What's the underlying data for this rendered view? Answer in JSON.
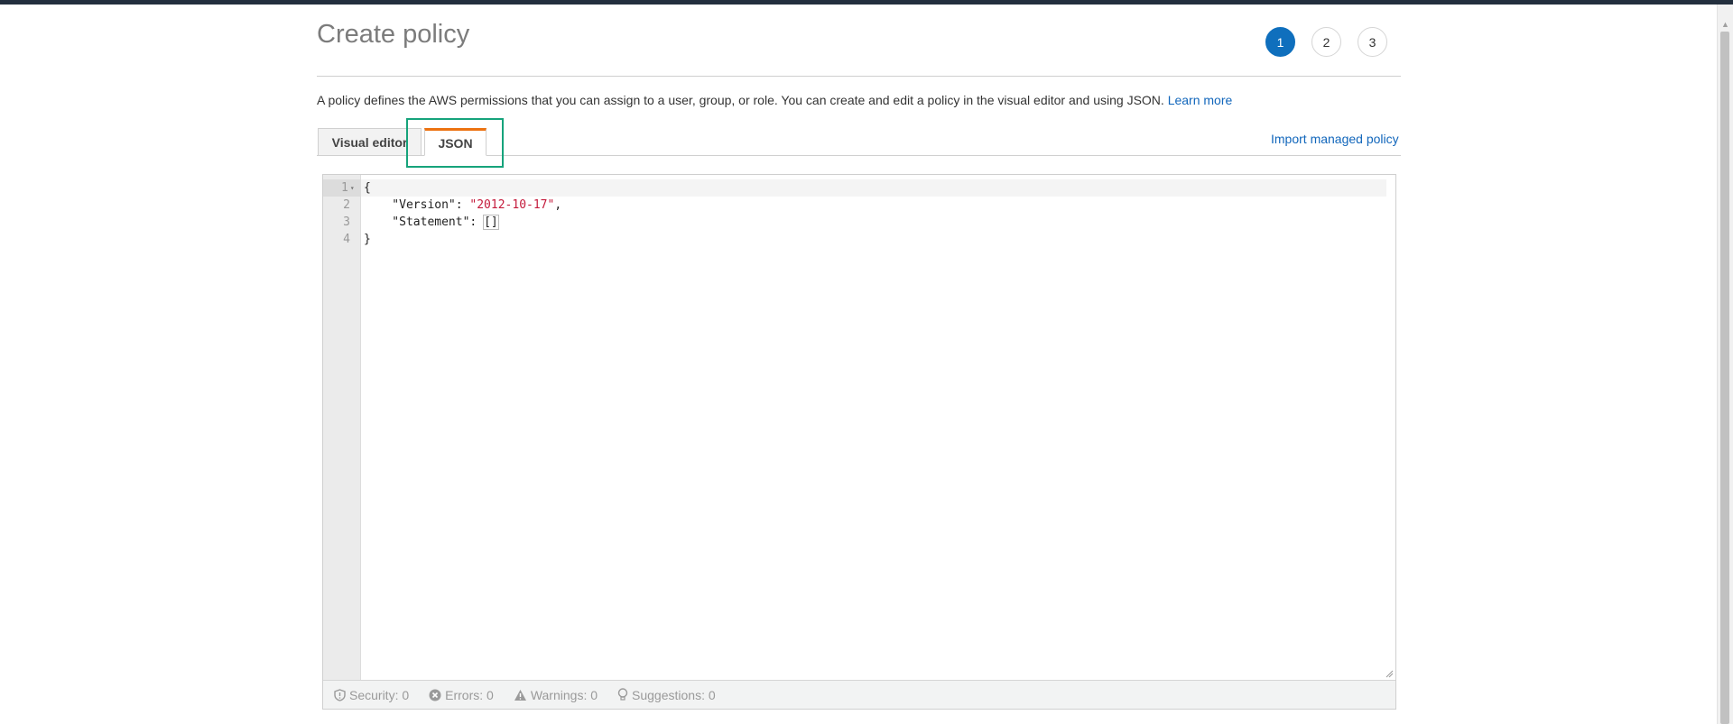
{
  "page": {
    "title": "Create policy",
    "steps": [
      "1",
      "2",
      "3"
    ],
    "description": "A policy defines the AWS permissions that you can assign to a user, group, or role. You can create and edit a policy in the visual editor and using JSON.",
    "learn_more": "Learn more"
  },
  "tabs": [
    {
      "label": "Visual editor",
      "active": false
    },
    {
      "label": "JSON",
      "active": true
    }
  ],
  "import_link": "Import managed policy",
  "editor": {
    "line_numbers": [
      "1",
      "2",
      "3",
      "4"
    ],
    "lines": {
      "l1": "{",
      "l2_key": "    \"Version\": ",
      "l2_val": "\"2012-10-17\"",
      "l2_end": ",",
      "l3_key": "    \"Statement\": ",
      "l3_val": "[]",
      "l4": "}"
    }
  },
  "status_bar": {
    "security": "Security: 0",
    "errors": "Errors: 0",
    "warnings": "Warnings: 0",
    "suggestions": "Suggestions: 0"
  },
  "colors": {
    "accent_orange": "#ec7211",
    "link_blue": "#1166bb",
    "step_active": "#0f6fbd",
    "highlight_green": "#16a37b"
  }
}
